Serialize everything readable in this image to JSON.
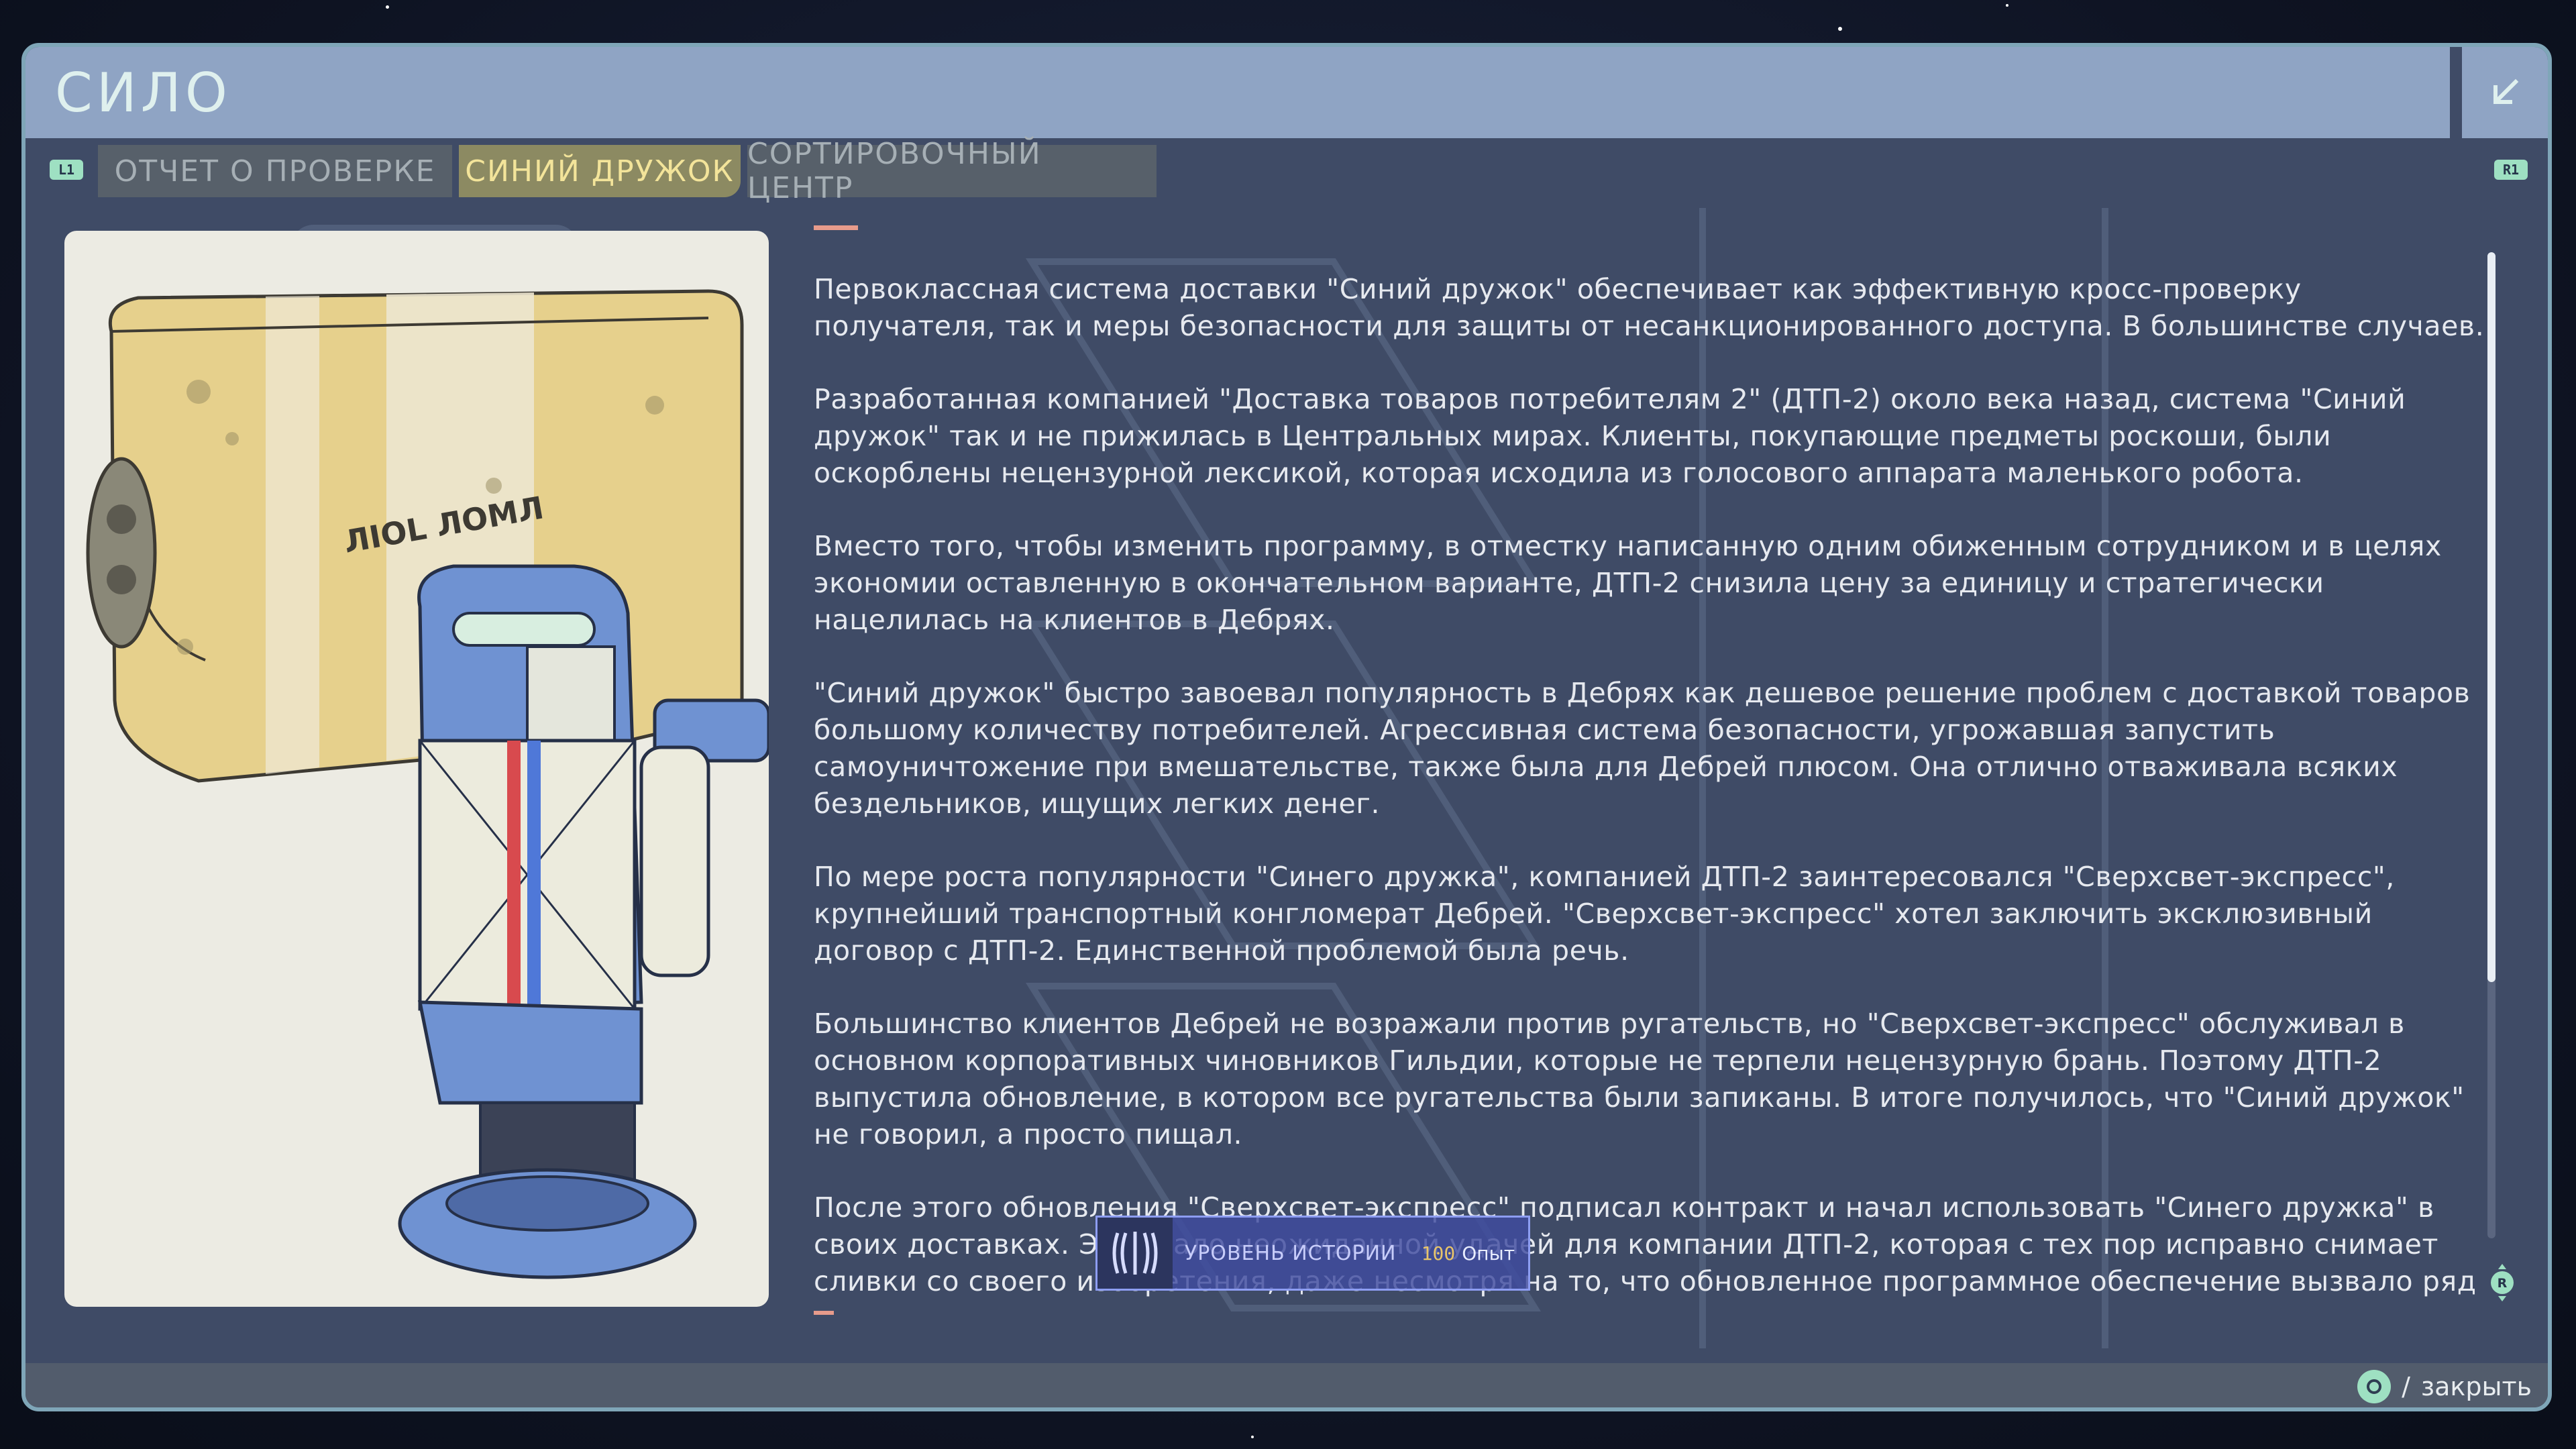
{
  "window": {
    "title": "СИЛО"
  },
  "tabs": {
    "left_hint": "L1",
    "right_hint": "R1",
    "items": [
      {
        "label": "ОТЧЕТ О ПРОВЕРКЕ"
      },
      {
        "label": "СИНИЙ ДРУЖОК"
      },
      {
        "label": "СОРТИРОВОЧНЫЙ ЦЕНТР"
      }
    ],
    "active_index": 1
  },
  "article": {
    "paragraphs": [
      "Первоклассная система доставки \"Синий дружок\" обеспечивает как эффективную кросс-проверку получателя, так и меры безопасности для защиты от несанкционированного доступа. В большинстве случаев.",
      "Разработанная компанией \"Доставка товаров потребителям 2\" (ДТП-2) около века назад, система \"Синий дружок\" так и не прижилась в Центральных мирах. Клиенты, покупающие предметы роскоши, были оскорблены нецензурной лексикой, которая исходила из голосового аппарата маленького робота.",
      "Вместо того, чтобы изменить программу, в отместку написанную одним обиженным сотрудником и в целях экономии оставленную в окончательном варианте, ДТП-2 снизила цену за единицу и стратегически нацелилась на клиентов в Дебрях.",
      "\"Синий дружок\" быстро завоевал популярность в Дебрях как дешевое решение проблем с доставкой товаров большому количеству потребителей. Агрессивная система безопасности, угрожавшая запустить самоуничтожение при вмешательстве, также была для Дебрей плюсом. Она отлично отваживала всяких бездельников, ищущих легких денег.",
      "По мере роста популярности \"Синего дружка\", компанией ДТП-2 заинтересовался \"Сверхсвет-экспресс\", крупнейший транспортный конгломерат Дебрей. \"Сверхсвет-экспресс\" хотел заключить эксклюзивный договор с ДТП-2. Единственной проблемой была речь.",
      "Большинство клиентов Дебрей не возражали против ругательств, но \"Сверхсвет-экспресс\" обслуживал в основном корпоративных чиновников Гильдии, которые не терпели нецензурную брань. Поэтому ДТП-2 выпустила обновление, в котором все ругательства были запиканы. В итоге получилось, что \"Синий дружок\" не говорил, а просто пищал.",
      "После этого обновления \"Сверхсвет-экспресс\" подписал контракт и начал использовать \"Синего дружка\" в своих доставках. Это стало неожиданной удачей для компании ДТП-2, которая с тех пор исправно снимает сливки со своего изобретения, даже несмотря на то, что обновленное программное обеспечение вызвало ряд новых"
    ]
  },
  "scroll": {
    "position_fraction": 0.0,
    "visible_fraction": 0.74
  },
  "scroll_hint": "R",
  "toast": {
    "title": "УРОВЕНЬ ИСТОРИИ",
    "xp_value": "100",
    "xp_unit": "Опыт"
  },
  "footer": {
    "separator": "/",
    "close_label": "закрыть"
  },
  "colors": {
    "accent_teal": "#9ee0c2",
    "active_tab_text": "#f3e49a",
    "title_text": "#dff0ee",
    "panel_bg": "#3f4b66"
  }
}
